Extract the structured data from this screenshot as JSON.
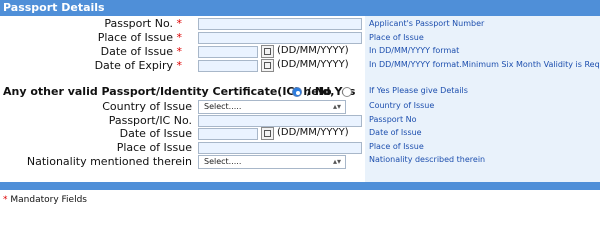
{
  "section": {
    "title": "Passport Details"
  },
  "fields": {
    "passport_no": {
      "label": "Passport No.",
      "hint": "Applicant's Passport Number"
    },
    "place_of_issue": {
      "label": "Place of Issue",
      "hint": "Place of Issue"
    },
    "date_of_issue": {
      "label": "Date of Issue",
      "format": "(DD/MM/YYYY)",
      "hint": "In DD/MM/YYYY format"
    },
    "date_of_expiry": {
      "label": "Date of Expiry",
      "format": "(DD/MM/YYYY)",
      "hint": "In DD/MM/YYYY format.Minimum Six Month Validity is Required."
    }
  },
  "other": {
    "question": "Any other valid Passport/Identity Certificate(IC) held,Yes",
    "no_label": "/ No",
    "hint": "If Yes Please give Details",
    "country_of_issue": {
      "label": "Country of Issue",
      "value": "Select.....",
      "hint": "Country of Issue"
    },
    "passport_ic_no": {
      "label": "Passport/IC No.",
      "hint": "Passport No"
    },
    "date_of_issue": {
      "label": "Date of Issue",
      "format": "(DD/MM/YYYY)",
      "hint": "Date of Issue"
    },
    "place_of_issue": {
      "label": "Place of Issue",
      "hint": "Place of Issue"
    },
    "nationality": {
      "label": "Nationality mentioned therein",
      "value": "Select.....",
      "hint": "Nationality described therein"
    }
  },
  "footer": {
    "asterisk": "*",
    "mandatory": "Mandatory Fields"
  },
  "required_mark": "*"
}
